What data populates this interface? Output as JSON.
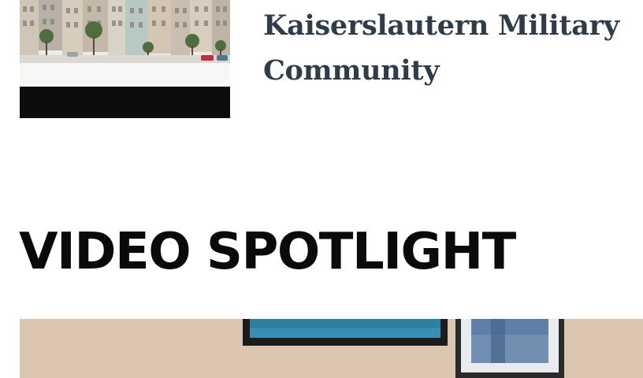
{
  "article": {
    "title": "Kaiserslautern Military Community",
    "thumbnail_alt": "Illustrated street of colorful town houses"
  },
  "video_spotlight": {
    "heading": "VIDEO SPOTLIGHT"
  },
  "colors": {
    "title_text": "#2f3d4a",
    "heading_text": "#0a0a0a"
  }
}
